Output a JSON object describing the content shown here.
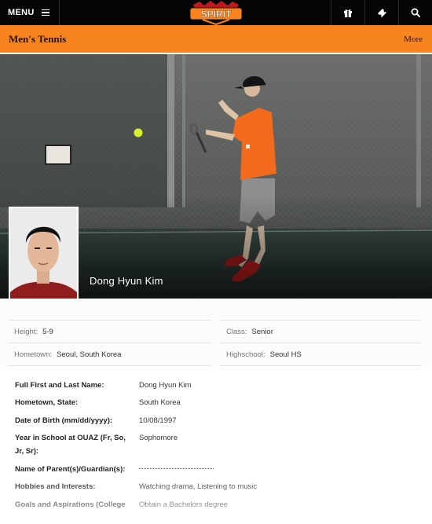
{
  "header": {
    "menu_label": "MENU",
    "logo_text": "SPIRIT",
    "icons": [
      "gift-icon",
      "ticket-icon",
      "search-icon"
    ]
  },
  "sport_bar": {
    "title": "Men's Tennis",
    "more_label": "More",
    "color": "#f7841f"
  },
  "hero": {
    "player_name": "Dong Hyun Kim"
  },
  "bio": {
    "height_label": "Height:",
    "height_value": "5-9",
    "class_label": "Class:",
    "class_value": "Senior",
    "hometown_label": "Hometown:",
    "hometown_value": "Seoul, South Korea",
    "highschool_label": "Highschool:",
    "highschool_value": "Seoul HS"
  },
  "questionnaire": [
    {
      "q": "Full First and Last Name:",
      "a": "Dong Hyun Kim"
    },
    {
      "q": "Hometown, State:",
      "a": "South Korea"
    },
    {
      "q": "Date of Birth (mm/dd/yyyy):",
      "a": "10/08/1997"
    },
    {
      "q": "Year in School at OUAZ (Fr, So, Jr, Sr):",
      "a": "Sophomore"
    },
    {
      "q": "Name of Parent(s)/Guardian(s):",
      "a": ""
    },
    {
      "q": "Hobbies and Interests:",
      "a": "Watching drama, Listening to music"
    },
    {
      "q": "Goals and Aspirations (College",
      "a": "Obtain a Bachelors degree"
    }
  ],
  "colors": {
    "accent": "#f7841f",
    "header_bg": "#050505",
    "shirt": "#f26a1b"
  }
}
